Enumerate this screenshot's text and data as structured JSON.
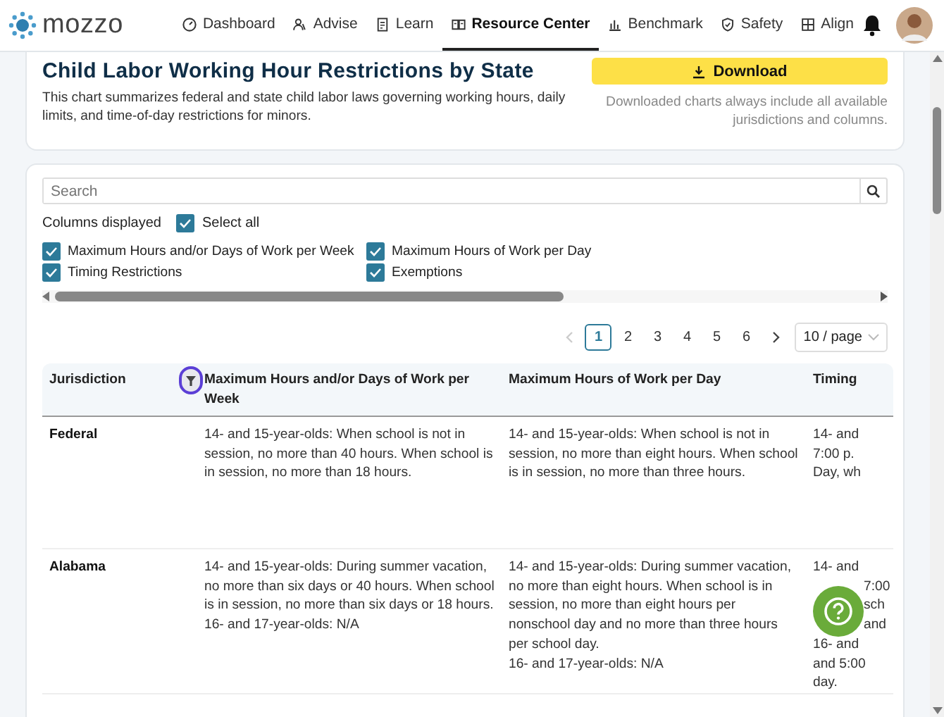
{
  "header": {
    "logo": "mozzo",
    "nav": [
      {
        "label": "Dashboard",
        "selected": false
      },
      {
        "label": "Advise",
        "selected": false
      },
      {
        "label": "Learn",
        "selected": false
      },
      {
        "label": "Resource Center",
        "selected": true
      },
      {
        "label": "Benchmark",
        "selected": false
      },
      {
        "label": "Safety",
        "selected": false
      },
      {
        "label": "Align",
        "selected": false
      }
    ]
  },
  "title_card": {
    "title": "Child Labor Working Hour Restrictions by State",
    "description": "This chart summarizes federal and state child labor laws governing working hours, daily limits, and time-of-day restrictions for minors.",
    "download_button": "Download",
    "download_note": "Downloaded charts always include all available jurisdictions and columns."
  },
  "filters": {
    "search": {
      "placeholder": "Search"
    },
    "columns_label": "Columns displayed",
    "select_all": {
      "label": "Select all",
      "checked": true
    },
    "columns": [
      {
        "label": "Maximum Hours and/or Days of Work per Week",
        "checked": true
      },
      {
        "label": "Maximum Hours of Work per Day",
        "checked": true
      },
      {
        "label": "Timing Restrictions",
        "checked": true
      },
      {
        "label": "Exemptions",
        "checked": true
      }
    ]
  },
  "pagination": {
    "pages": [
      {
        "label": "1",
        "selected": true
      },
      {
        "label": "2",
        "selected": false
      },
      {
        "label": "3",
        "selected": false
      },
      {
        "label": "4",
        "selected": false
      },
      {
        "label": "5",
        "selected": false
      },
      {
        "label": "6",
        "selected": false
      }
    ],
    "page_size": "10 / page"
  },
  "table": {
    "columns": [
      "Jurisdiction",
      "Maximum Hours and/or Days of Work per Week",
      "Maximum Hours of Work per Day",
      "Timing"
    ],
    "rows": [
      {
        "jurisdiction": "Federal",
        "week": [
          "14- and 15-year-olds: When school is not in session, no more than 40 hours. When school is in session, no more than 18 hours."
        ],
        "day": [
          "14- and 15-year-olds: When school is not in session, no more than eight hours. When school is in session, no more than three hours."
        ],
        "timing": [
          {
            "text": "14- and",
            "covered": false
          },
          {
            "text": "7:00 p.",
            "covered": false
          },
          {
            "text": "Day, wh",
            "covered": false
          }
        ]
      },
      {
        "jurisdiction": "Alabama",
        "week": [
          "14- and 15-year-olds: During summer vacation, no more than six days or 40 hours. When school is in session, no more than six days or 18 hours.",
          "16- and 17-year-olds: N/A"
        ],
        "day": [
          "14- and 15-year-olds: During summer vacation, no more than eight hours. When school is in session, no more than eight hours per nonschool day and no more than three hours per school day.",
          "16- and 17-year-olds: N/A"
        ],
        "timing": [
          {
            "text": "14- and",
            "covered": false
          },
          {
            "text": "7:00",
            "covered": true
          },
          {
            "text": "sch",
            "covered": true
          },
          {
            "text": "and",
            "covered": true
          },
          {
            "text": "16- and",
            "covered": false
          },
          {
            "text": "and 5:00",
            "covered": false
          },
          {
            "text": "day.",
            "covered": false
          }
        ]
      }
    ]
  }
}
